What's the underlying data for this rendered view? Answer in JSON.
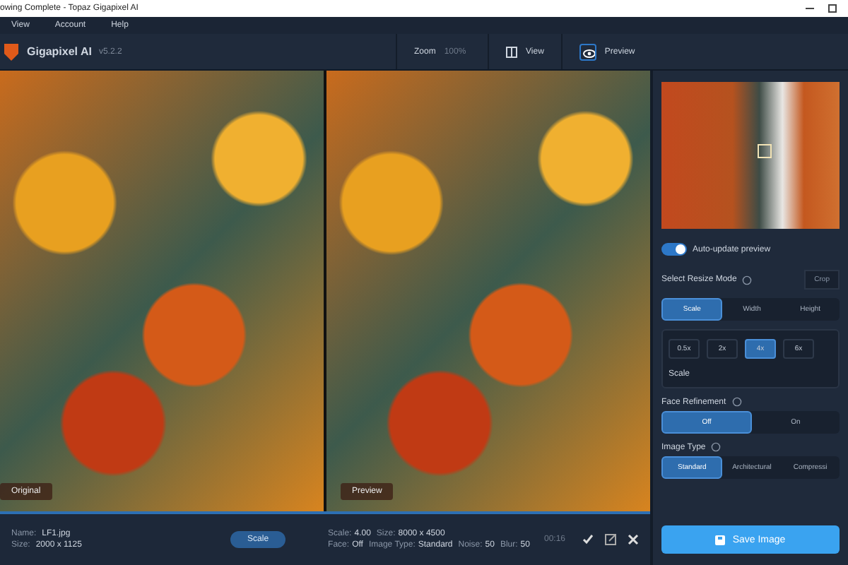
{
  "window": {
    "title": "owing Complete - Topaz Gigapixel AI"
  },
  "menu": [
    "View",
    "Account",
    "Help"
  ],
  "app": {
    "name": "Gigapixel AI",
    "version": "v5.2.2"
  },
  "toolbar": {
    "zoom_label": "Zoom",
    "zoom_value": "100%",
    "view_label": "View",
    "preview_label": "Preview",
    "preview_on": true
  },
  "panes": [
    {
      "label": "Original"
    },
    {
      "label": "Preview"
    }
  ],
  "sidebar": {
    "auto_update": {
      "label": "Auto-update preview",
      "on": true
    },
    "resize_mode": {
      "label": "Select Resize Mode",
      "crop": "Crop",
      "options": [
        {
          "label": "Scale",
          "selected": true
        },
        {
          "label": "Width",
          "selected": false
        },
        {
          "label": "Height",
          "selected": false
        }
      ]
    },
    "scales": [
      {
        "label": "0.5x",
        "selected": false
      },
      {
        "label": "2x",
        "selected": false
      },
      {
        "label": "4x",
        "selected": true
      },
      {
        "label": "6x",
        "selected": false
      }
    ],
    "scale_caption": "Scale",
    "face": {
      "label": "Face Refinement",
      "options": [
        {
          "label": "Off",
          "selected": true
        },
        {
          "label": "On",
          "selected": false
        }
      ]
    },
    "image_type": {
      "label": "Image Type",
      "options": [
        {
          "label": "Standard",
          "selected": true
        },
        {
          "label": "Architectural",
          "selected": false
        },
        {
          "label": "Compressi",
          "selected": false
        }
      ]
    },
    "save": "Save Image"
  },
  "status": {
    "name_label": "Name:",
    "name": "LF1.jpg",
    "size_label": "Size:",
    "size": "2000 x 1125",
    "mode": "Scale",
    "line1": [
      {
        "k": "Scale:",
        "v": "4.00"
      },
      {
        "k": "Size:",
        "v": "8000 x 4500"
      }
    ],
    "line2": [
      {
        "k": "Face:",
        "v": "Off"
      },
      {
        "k": "Image Type:",
        "v": "Standard"
      },
      {
        "k": "Noise:",
        "v": "50"
      },
      {
        "k": "Blur:",
        "v": "50"
      }
    ],
    "time": "00:16"
  }
}
